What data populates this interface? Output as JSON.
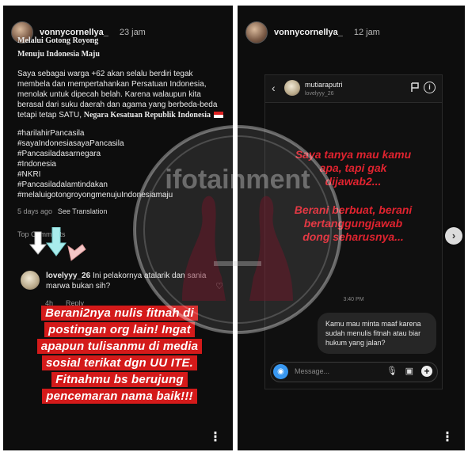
{
  "left_story": {
    "username": "vonnycornellya_",
    "time": "23 jam",
    "caption_lines": [
      "Melalui Gotong Royong",
      "Menuju Indonesia Maju"
    ],
    "body": "Saya sebagai warga +62 akan selalu berdiri tegak membela dan mempertahankan Persatuan Indonesia, menolak untuk dipecah belah. Karena walaupun kita berasal dari suku daerah dan agama yang berbeda-beda tetapi tetap SATU,",
    "body_bold": "Negara Kesatuan Republik Indonesia",
    "hashtags": [
      "#harilahirPancasila",
      "#sayaIndonesiasayaPancasila",
      "#Pancasiladasarnegara",
      "#Indonesia",
      "#NKRI",
      "#Pancasiladalamtindakan",
      "#melaluigotongroyongmenujuIndonesiamaju"
    ],
    "meta_time": "5 days ago",
    "see_translation": "See Translation",
    "top_comments": "Top Comments",
    "comment_user": "lovelyyy_26",
    "comment_text": "Ini pelakornya atalarik dan sania marwa bukan sih?",
    "comment_time": "4h",
    "reply_label": "Reply",
    "red_lines": [
      "Berani2nya nulis fitnah di",
      "postingan org lain! Ingat",
      "apapun tulisanmu di media",
      "sosial terikat dgn UU ITE.",
      "Fitnahmu bs berujung",
      "pencemaran nama baik!!!"
    ],
    "more_icon": "vertical-dots-icon"
  },
  "right_story": {
    "username": "vonnycornellya_",
    "time": "12 jam",
    "dm": {
      "contact_name": "mutiaraputri",
      "contact_sub": "lovelyyy_26",
      "overlay_1": [
        "Saya tanya mau kamu",
        "apa, tapi gak",
        "dijawab2..."
      ],
      "overlay_2": [
        "Berani berbuat, berani",
        "bertanggungjawab",
        "dong seharusnya..."
      ],
      "timestamp": "3:40 PM",
      "bubble_text": "Kamu mau minta maaf karena sudah menulis fitnah atau biar hukum yang jalan?",
      "input_placeholder": "Message..."
    }
  },
  "watermark": "ifotainment",
  "colors": {
    "red_banner": "#d41a1a",
    "overlay_red": "#e0232f",
    "camera_blue": "#3897f0"
  }
}
